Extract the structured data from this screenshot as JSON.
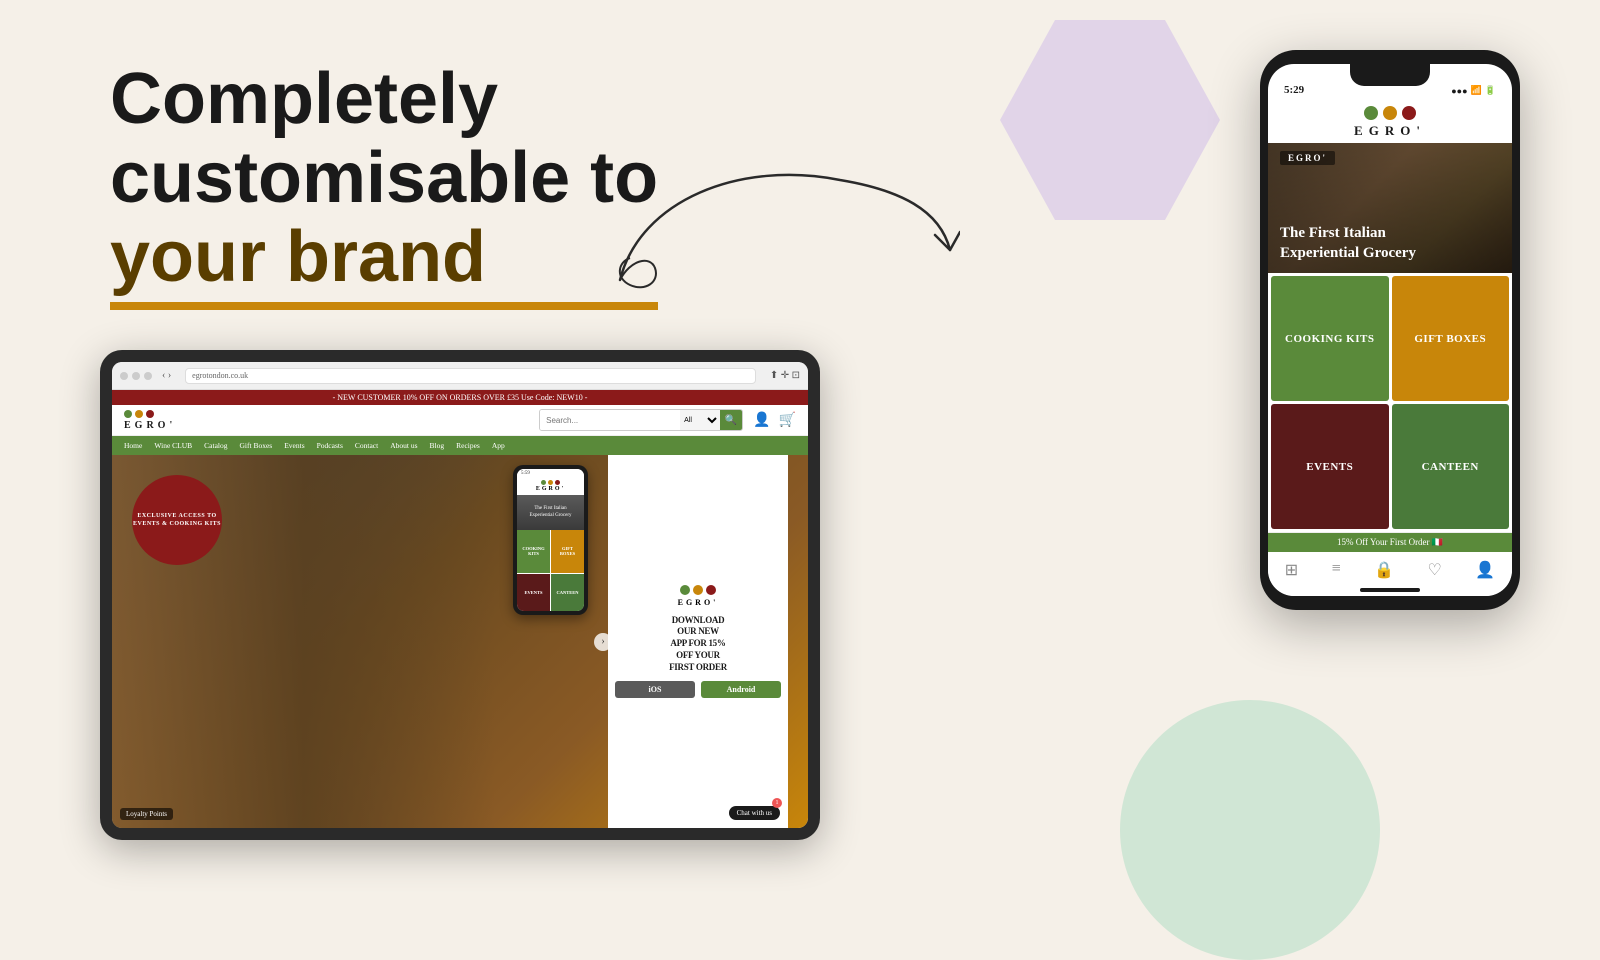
{
  "background_color": "#f5f0e8",
  "heading": {
    "line1": "Completely",
    "line2": "customisable to",
    "line3": "your brand"
  },
  "decorative_shapes": {
    "purple_color": "#d8c8e8",
    "green_color": "#b8e0c8"
  },
  "tablet": {
    "browser_url": "egrotondon.co.uk",
    "announcement": "- NEW CUSTOMER 10% OFF ON ORDERS OVER £35 Use Code: NEW10 -",
    "brand_name": "EGRO'",
    "search_placeholder": "Search...",
    "search_category": "All",
    "nav_items": [
      "Home",
      "Wine CLUB",
      "Catalog",
      "Gift Boxes",
      "Events",
      "Podcasts",
      "Contact",
      "About us",
      "Blog",
      "Recipes",
      "App"
    ],
    "hero": {
      "badge_text": "EXCLUSIVE\nACCESS TO\nEVENTS &\nCOOKING KITS"
    },
    "download": {
      "text": "DOWNLOAD\nOUR NEW\nAPP FOR 15%\nOFF YOUR\nFIRST ORDER",
      "ios_btn": "iOS",
      "android_btn": "Android"
    },
    "loyalty_text": "Loyalty Points",
    "chat_btn": "Chat with us"
  },
  "phone": {
    "status_bar": {
      "time": "5:29",
      "signal": "●●●",
      "wifi": "WiFi",
      "battery": "■"
    },
    "brand_name": "EGRO'",
    "hero_banner": {
      "store_label": "EGRO'",
      "tagline": "The First Italian\nExperiential Grocery"
    },
    "grid_items": [
      {
        "label": "COOKING KITS",
        "color_class": "cell-green"
      },
      {
        "label": "GIFT BOXES",
        "color_class": "cell-yellow"
      },
      {
        "label": "EVENTS",
        "color_class": "cell-darkred"
      },
      {
        "label": "CANTEEN",
        "color_class": "cell-olive"
      }
    ],
    "offer_text": "15% Off Your First Order 🇮🇹",
    "bottom_nav_icons": [
      "⊞",
      "≡",
      "🔒",
      "♡",
      "👤"
    ]
  }
}
